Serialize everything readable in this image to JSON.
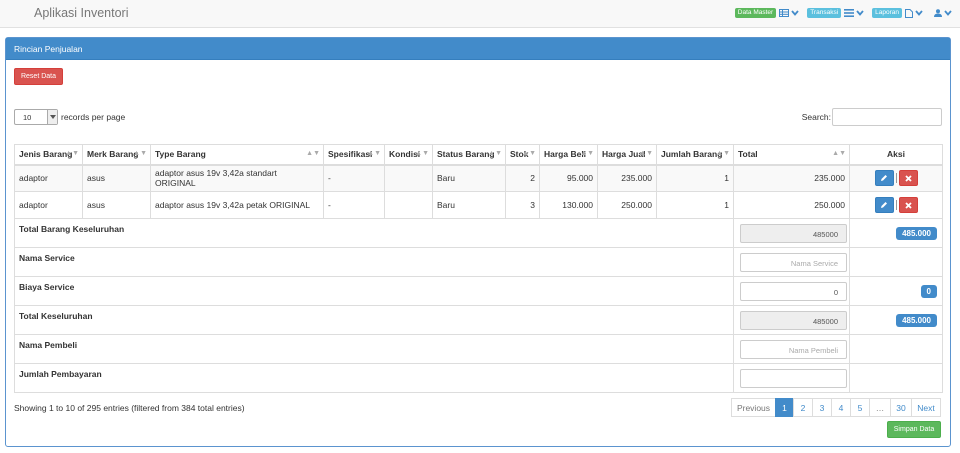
{
  "app": {
    "title": "Aplikasi Inventori"
  },
  "nav": {
    "items": [
      {
        "label": "Data Master",
        "color": "#5cb85c",
        "icon": "table-icon"
      },
      {
        "label": "Transaksi",
        "color": "#5bc0de",
        "icon": "list-icon"
      },
      {
        "label": "Laporan",
        "color": "#5bc0de",
        "icon": "file-icon"
      }
    ],
    "user_icon": "user-icon",
    "accent": "#428bca"
  },
  "panel": {
    "title": "Rincian Penjualan"
  },
  "actions": {
    "reset_label": "Reset Data",
    "save_label": "Simpan Data"
  },
  "table_controls": {
    "length_value": "10",
    "length_label": "records per page",
    "search_label": "Search:",
    "search_value": ""
  },
  "table": {
    "columns": [
      "Jenis Barang",
      "Merk Barang",
      "Type Barang",
      "Spesifikasi",
      "Kondisi",
      "Status Barang",
      "Stok",
      "Harga Beli",
      "Harga Jual",
      "Jumlah Barang",
      "Total",
      "Aksi"
    ],
    "rows": [
      {
        "jenis": "adaptor",
        "merk": "asus",
        "type": "adaptor asus 19v 3,42a standart ORIGINAL",
        "spesifikasi": "-",
        "kondisi": "",
        "status": "Baru",
        "stok": "2",
        "harga_beli": "95.000",
        "harga_jual": "235.000",
        "jumlah": "1",
        "total": "235.000"
      },
      {
        "jenis": "adaptor",
        "merk": "asus",
        "type": "adaptor asus 19v 3,42a petak ORIGINAL",
        "spesifikasi": "-",
        "kondisi": "",
        "status": "Baru",
        "stok": "3",
        "harga_beli": "130.000",
        "harga_jual": "250.000",
        "jumlah": "1",
        "total": "250.000"
      }
    ]
  },
  "summary": {
    "total_barang": {
      "label": "Total Barang Keseluruhan",
      "value": "485000",
      "badge": "485.000"
    },
    "nama_service": {
      "label": "Nama Service",
      "value": "",
      "placeholder": "Nama Service"
    },
    "biaya_service": {
      "label": "Biaya Service",
      "value": "0",
      "badge": "0"
    },
    "total_keseluruhan": {
      "label": "Total Keseluruhan",
      "value": "485000",
      "badge": "485.000"
    },
    "nama_pembeli": {
      "label": "Nama Pembeli",
      "value": "",
      "placeholder": "Nama Pembeli"
    },
    "jumlah_pembayaran": {
      "label": "Jumlah Pembayaran",
      "value": ""
    }
  },
  "footer": {
    "info": "Showing 1 to 10 of 295 entries (filtered from 384 total entries)",
    "pagination": [
      "Previous",
      "1",
      "2",
      "3",
      "4",
      "5",
      "…",
      "30",
      "Next"
    ],
    "active_page": "1"
  }
}
